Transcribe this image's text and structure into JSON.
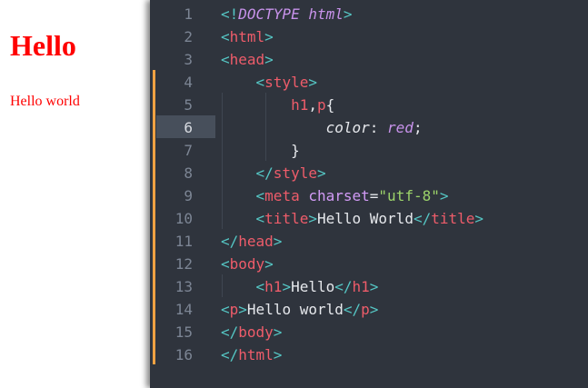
{
  "preview": {
    "heading": "Hello",
    "paragraph": "Hello world"
  },
  "colors": {
    "preview_text": "#ff0000",
    "editor_bg": "#2f343d",
    "active_line_gutter": "#474f5b",
    "change_marker": "#f0a243",
    "punctuation": "#55c6c4",
    "tag": "#ee5c6a",
    "attribute": "#d29bf6",
    "string": "#9cd36a",
    "keyword_italic": "#c792ea"
  },
  "editor": {
    "active_line": 6,
    "lines": [
      {
        "num": "1",
        "tokens": [
          [
            "pun",
            "<!"
          ],
          [
            "doc",
            "DOCTYPE"
          ],
          [
            "txt",
            " "
          ],
          [
            "doc",
            "html"
          ],
          [
            "pun",
            ">"
          ]
        ]
      },
      {
        "num": "2",
        "tokens": [
          [
            "pun",
            "<"
          ],
          [
            "tag",
            "html"
          ],
          [
            "pun",
            ">"
          ]
        ]
      },
      {
        "num": "3",
        "tokens": [
          [
            "pun",
            "<"
          ],
          [
            "tag",
            "head"
          ],
          [
            "pun",
            ">"
          ]
        ]
      },
      {
        "num": "4",
        "tokens": [
          [
            "txt",
            "    "
          ],
          [
            "pun",
            "<"
          ],
          [
            "tag",
            "style"
          ],
          [
            "pun",
            ">"
          ]
        ]
      },
      {
        "num": "5",
        "tokens": [
          [
            "txt",
            "        "
          ],
          [
            "sel",
            "h1"
          ],
          [
            "txt",
            ","
          ],
          [
            "sel",
            "p"
          ],
          [
            "txt",
            "{"
          ]
        ]
      },
      {
        "num": "6",
        "tokens": [
          [
            "txt",
            "            "
          ],
          [
            "prop",
            "color"
          ],
          [
            "txt",
            ": "
          ],
          [
            "val",
            "red"
          ],
          [
            "txt",
            ";"
          ]
        ]
      },
      {
        "num": "7",
        "tokens": [
          [
            "txt",
            "        "
          ],
          [
            "txt",
            "}"
          ]
        ]
      },
      {
        "num": "8",
        "tokens": [
          [
            "txt",
            "    "
          ],
          [
            "pun",
            "</"
          ],
          [
            "tag",
            "style"
          ],
          [
            "pun",
            ">"
          ]
        ]
      },
      {
        "num": "9",
        "tokens": [
          [
            "txt",
            "    "
          ],
          [
            "pun",
            "<"
          ],
          [
            "tag",
            "meta"
          ],
          [
            "txt",
            " "
          ],
          [
            "att",
            "charset"
          ],
          [
            "txt",
            "="
          ],
          [
            "str",
            "\"utf-8\""
          ],
          [
            "pun",
            ">"
          ]
        ]
      },
      {
        "num": "10",
        "tokens": [
          [
            "txt",
            "    "
          ],
          [
            "pun",
            "<"
          ],
          [
            "tag",
            "title"
          ],
          [
            "pun",
            ">"
          ],
          [
            "txt",
            "Hello World"
          ],
          [
            "pun",
            "</"
          ],
          [
            "tag",
            "title"
          ],
          [
            "pun",
            ">"
          ]
        ]
      },
      {
        "num": "11",
        "tokens": [
          [
            "pun",
            "</"
          ],
          [
            "tag",
            "head"
          ],
          [
            "pun",
            ">"
          ]
        ]
      },
      {
        "num": "12",
        "tokens": [
          [
            "pun",
            "<"
          ],
          [
            "tag",
            "body"
          ],
          [
            "pun",
            ">"
          ]
        ]
      },
      {
        "num": "13",
        "tokens": [
          [
            "txt",
            "    "
          ],
          [
            "pun",
            "<"
          ],
          [
            "tag",
            "h1"
          ],
          [
            "pun",
            ">"
          ],
          [
            "txt",
            "Hello"
          ],
          [
            "pun",
            "</"
          ],
          [
            "tag",
            "h1"
          ],
          [
            "pun",
            ">"
          ]
        ]
      },
      {
        "num": "14",
        "tokens": [
          [
            "pun",
            "<"
          ],
          [
            "tag",
            "p"
          ],
          [
            "pun",
            ">"
          ],
          [
            "txt",
            "Hello world"
          ],
          [
            "pun",
            "</"
          ],
          [
            "tag",
            "p"
          ],
          [
            "pun",
            ">"
          ]
        ]
      },
      {
        "num": "15",
        "tokens": [
          [
            "pun",
            "</"
          ],
          [
            "tag",
            "body"
          ],
          [
            "pun",
            ">"
          ]
        ]
      },
      {
        "num": "16",
        "tokens": [
          [
            "pun",
            "</"
          ],
          [
            "tag",
            "html"
          ],
          [
            "pun",
            ">"
          ]
        ]
      }
    ]
  }
}
